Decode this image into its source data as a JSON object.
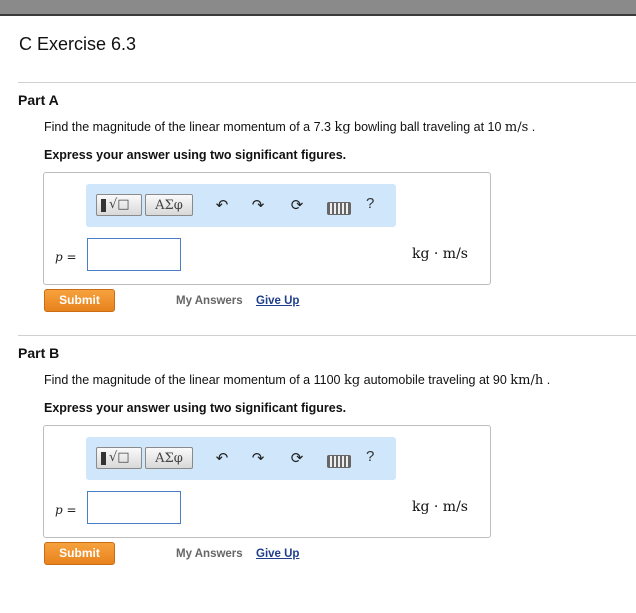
{
  "exercise_title": "C Exercise 6.3",
  "toolbar": {
    "symbols_label": "ΑΣφ",
    "template_glyph": "√□",
    "undo_glyph": "↶",
    "redo_glyph": "↷",
    "reset_glyph": "⟳",
    "help_label": "?"
  },
  "part_a": {
    "title": "Part A",
    "question_pre": "Find the magnitude of the linear momentum of a 7.3 ",
    "mass_unit": "kg",
    "question_mid": " bowling ball traveling at 10 ",
    "speed_unit": "m/s",
    "question_post": " .",
    "instruction": "Express your answer using two significant figures.",
    "var_label": "p =",
    "answer_value": "",
    "unit_label": "kg · m/s",
    "submit_label": "Submit",
    "my_answers_label": "My Answers",
    "give_up_label": "Give Up"
  },
  "part_b": {
    "title": "Part B",
    "question_pre": "Find the magnitude of the linear momentum of a 1100 ",
    "mass_unit": "kg",
    "question_mid": " automobile traveling at 90 ",
    "speed_unit": "km/h",
    "question_post": " .",
    "instruction": "Express your answer using two significant figures.",
    "var_label": "p =",
    "answer_value": "",
    "unit_label": "kg · m/s",
    "submit_label": "Submit",
    "my_answers_label": "My Answers",
    "give_up_label": "Give Up"
  }
}
